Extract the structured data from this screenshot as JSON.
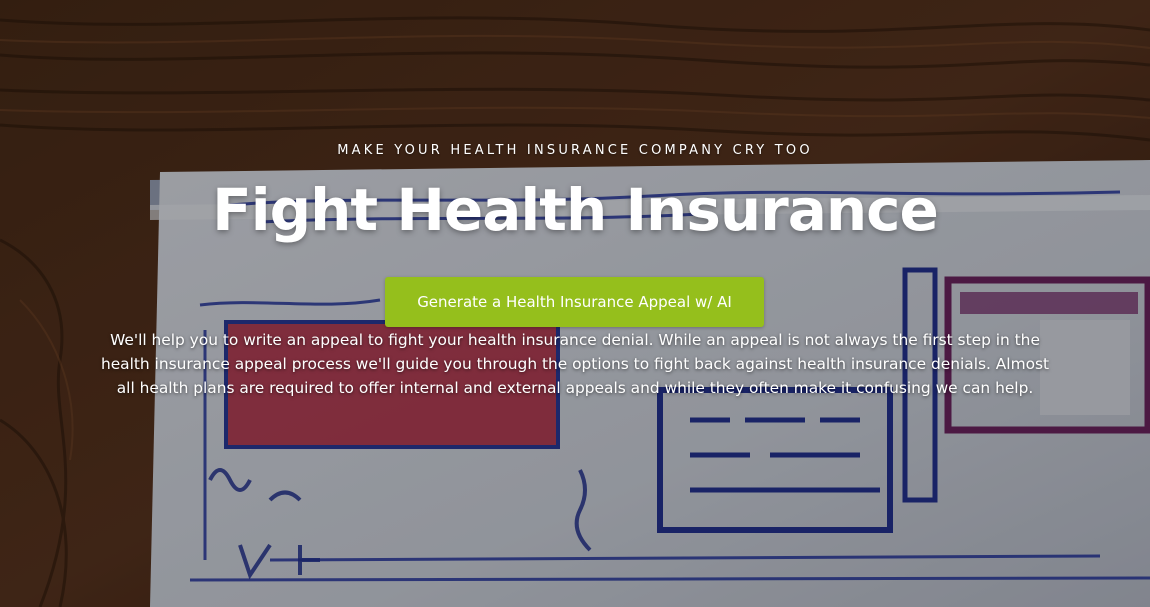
{
  "hero": {
    "tagline": "MAKE YOUR HEALTH INSURANCE COMPANY CRY TOO",
    "title": "Fight Health Insurance",
    "cta_label": "Generate a Health Insurance Appeal w/ AI",
    "description": "We'll help you to write an appeal to fight your health insurance denial. While an appeal is not always the first step in the health insurance appeal process we'll guide you through the options to fight back against health insurance denials. Almost all health plans are required to offer internal and external appeals and while they often make it confusing we can help.",
    "button_color": "#95bf1c"
  }
}
